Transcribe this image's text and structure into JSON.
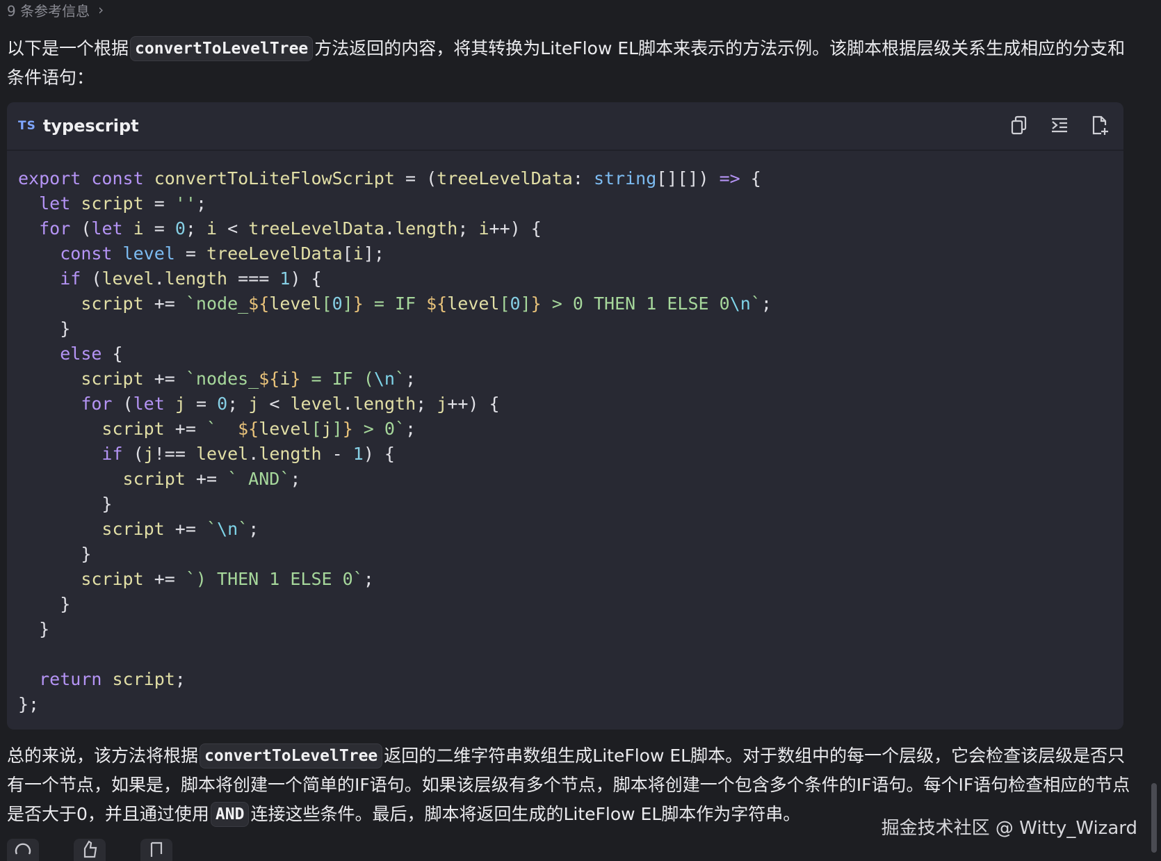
{
  "refs": {
    "label": "9 条参考信息",
    "chevron": "chevron-right-icon"
  },
  "intro": {
    "before": "以下是一个根据",
    "chip": "convertToLevelTree",
    "after": "方法返回的内容，将其转换为LiteFlow EL脚本来表示的方法示例。该脚本根据层级关系生成相应的分支和条件语句："
  },
  "code_block": {
    "language_badge": "TS",
    "language": "typescript",
    "icons": [
      "copy-icon",
      "insert-icon",
      "new-file-icon"
    ],
    "lines": [
      "export const convertToLiteFlowScript = (treeLevelData: string[][]) => {",
      "  let script = '';",
      "  for (let i = 0; i < treeLevelData.length; i++) {",
      "    const level = treeLevelData[i];",
      "    if (level.length === 1) {",
      "      script += `node_${level[0]} = IF ${level[0]} > 0 THEN 1 ELSE 0\\n`;",
      "    }",
      "    else {",
      "      script += `nodes_${i} = IF (\\n`;",
      "      for (let j = 0; j < level.length; j++) {",
      "        script += `  ${level[j]} > 0`;",
      "        if (j!== level.length - 1) {",
      "          script += ` AND`;",
      "        }",
      "        script += `\\n`;",
      "      }",
      "      script += `) THEN 1 ELSE 0`;",
      "    }",
      "  }",
      "",
      "  return script;",
      "};"
    ]
  },
  "summary": {
    "part1": "总的来说，该方法将根据",
    "chip1": "convertToLevelTree",
    "part2": "返回的二维字符串数组生成LiteFlow EL脚本。对于数组中的每一个层级，它会检查该层级是否只有一个节点，如果是，脚本将创建一个简单的IF语句。如果该层级有多个节点，脚本将创建一个包含多个条件的IF语句。每个IF语句检查相应的节点是否大于0，并且通过使用",
    "chip2": "AND",
    "part3": "连接这些条件。最后，脚本将返回生成的LiteFlow EL脚本作为字符串。"
  },
  "watermark": "掘金技术社区 @ Witty_Wizard",
  "bottom_actions": [
    "refresh-icon",
    "thumbs-up-icon",
    "thumbs-down-icon"
  ]
}
